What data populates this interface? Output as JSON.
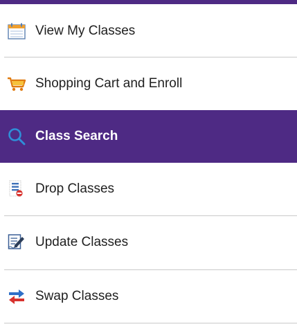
{
  "menu": {
    "items": [
      {
        "label": "View My Classes",
        "icon": "calendar-icon"
      },
      {
        "label": "Shopping Cart and Enroll",
        "icon": "shopping-cart-icon"
      },
      {
        "label": "Class Search",
        "icon": "search-icon",
        "active": true
      },
      {
        "label": "Drop Classes",
        "icon": "drop-list-icon"
      },
      {
        "label": "Update Classes",
        "icon": "edit-document-icon"
      },
      {
        "label": "Swap Classes",
        "icon": "swap-arrows-icon"
      }
    ]
  },
  "colors": {
    "active_background": "#4e2a84",
    "active_text": "#ffffff",
    "text": "#1f1f1f",
    "divider": "#c9c9c9"
  }
}
